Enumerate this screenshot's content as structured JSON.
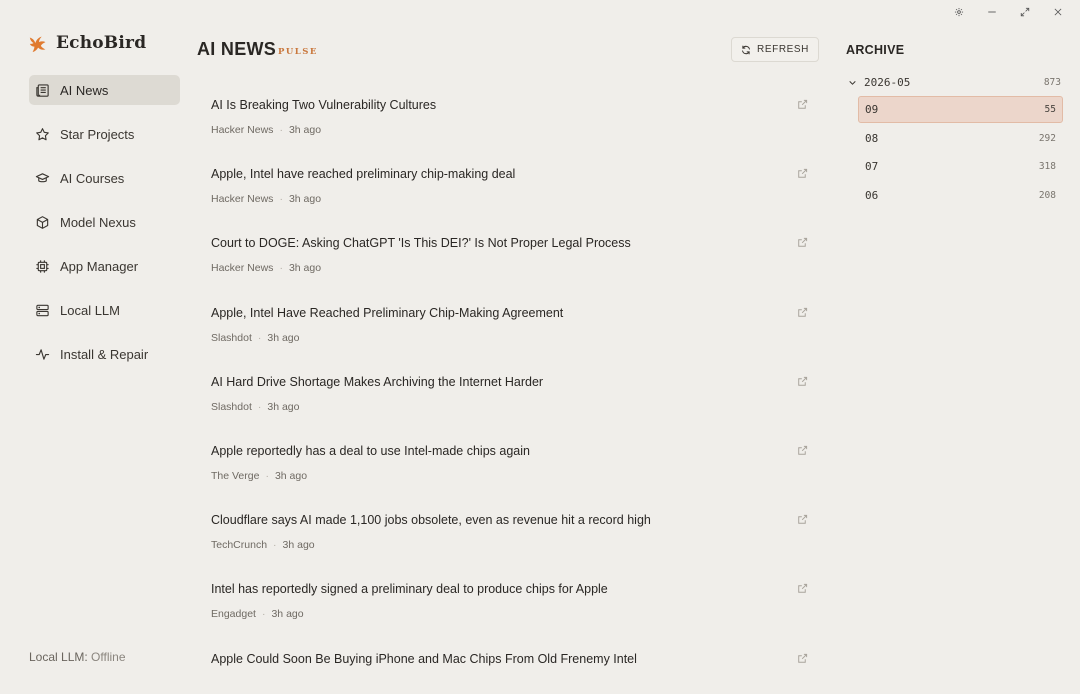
{
  "app": {
    "name": "EchoBird",
    "accent": "#e07a2f"
  },
  "window_controls": [
    {
      "name": "settings-button",
      "icon": "gear-icon"
    },
    {
      "name": "minimize-button",
      "icon": "minimize-icon"
    },
    {
      "name": "maximize-button",
      "icon": "expand-icon"
    },
    {
      "name": "close-button",
      "icon": "close-icon"
    }
  ],
  "sidebar": {
    "items": [
      {
        "label": "AI News",
        "icon": "newspaper-icon",
        "active": true
      },
      {
        "label": "Star Projects",
        "icon": "star-icon",
        "active": false
      },
      {
        "label": "AI Courses",
        "icon": "graduation-cap-icon",
        "active": false
      },
      {
        "label": "Model Nexus",
        "icon": "cube-icon",
        "active": false
      },
      {
        "label": "App Manager",
        "icon": "chip-icon",
        "active": false
      },
      {
        "label": "Local LLM",
        "icon": "server-icon",
        "active": false
      },
      {
        "label": "Install & Repair",
        "icon": "activity-icon",
        "active": false
      }
    ],
    "status_label": "Local LLM:",
    "status_value": "Offline"
  },
  "main": {
    "title": "AI NEWS",
    "subtitle": "PULSE",
    "refresh_label": "REFRESH",
    "news": [
      {
        "title": "AI Is Breaking Two Vulnerability Cultures",
        "source": "Hacker News",
        "time": "3h ago"
      },
      {
        "title": "Apple, Intel have reached preliminary chip-making deal",
        "source": "Hacker News",
        "time": "3h ago"
      },
      {
        "title": "Court to DOGE: Asking ChatGPT 'Is This DEI?' Is Not Proper Legal Process",
        "source": "Hacker News",
        "time": "3h ago"
      },
      {
        "title": "Apple, Intel Have Reached Preliminary Chip-Making Agreement",
        "source": "Slashdot",
        "time": "3h ago"
      },
      {
        "title": "AI Hard Drive Shortage Makes Archiving the Internet Harder",
        "source": "Slashdot",
        "time": "3h ago"
      },
      {
        "title": "Apple reportedly has a deal to use Intel-made chips again",
        "source": "The Verge",
        "time": "3h ago"
      },
      {
        "title": "Cloudflare says AI made 1,100 jobs obsolete, even as revenue hit a record high",
        "source": "TechCrunch",
        "time": "3h ago"
      },
      {
        "title": "Intel has reportedly signed a preliminary deal to produce chips for Apple",
        "source": "Engadget",
        "time": "3h ago"
      },
      {
        "title": "Apple Could Soon Be Buying iPhone and Mac Chips From Old Frenemy Intel",
        "source": "",
        "time": ""
      }
    ]
  },
  "archive": {
    "title": "ARCHIVE",
    "year": {
      "label": "2026-05",
      "count": "873"
    },
    "months": [
      {
        "label": "09",
        "count": "55",
        "active": true
      },
      {
        "label": "08",
        "count": "292",
        "active": false
      },
      {
        "label": "07",
        "count": "318",
        "active": false
      },
      {
        "label": "06",
        "count": "208",
        "active": false
      }
    ]
  }
}
